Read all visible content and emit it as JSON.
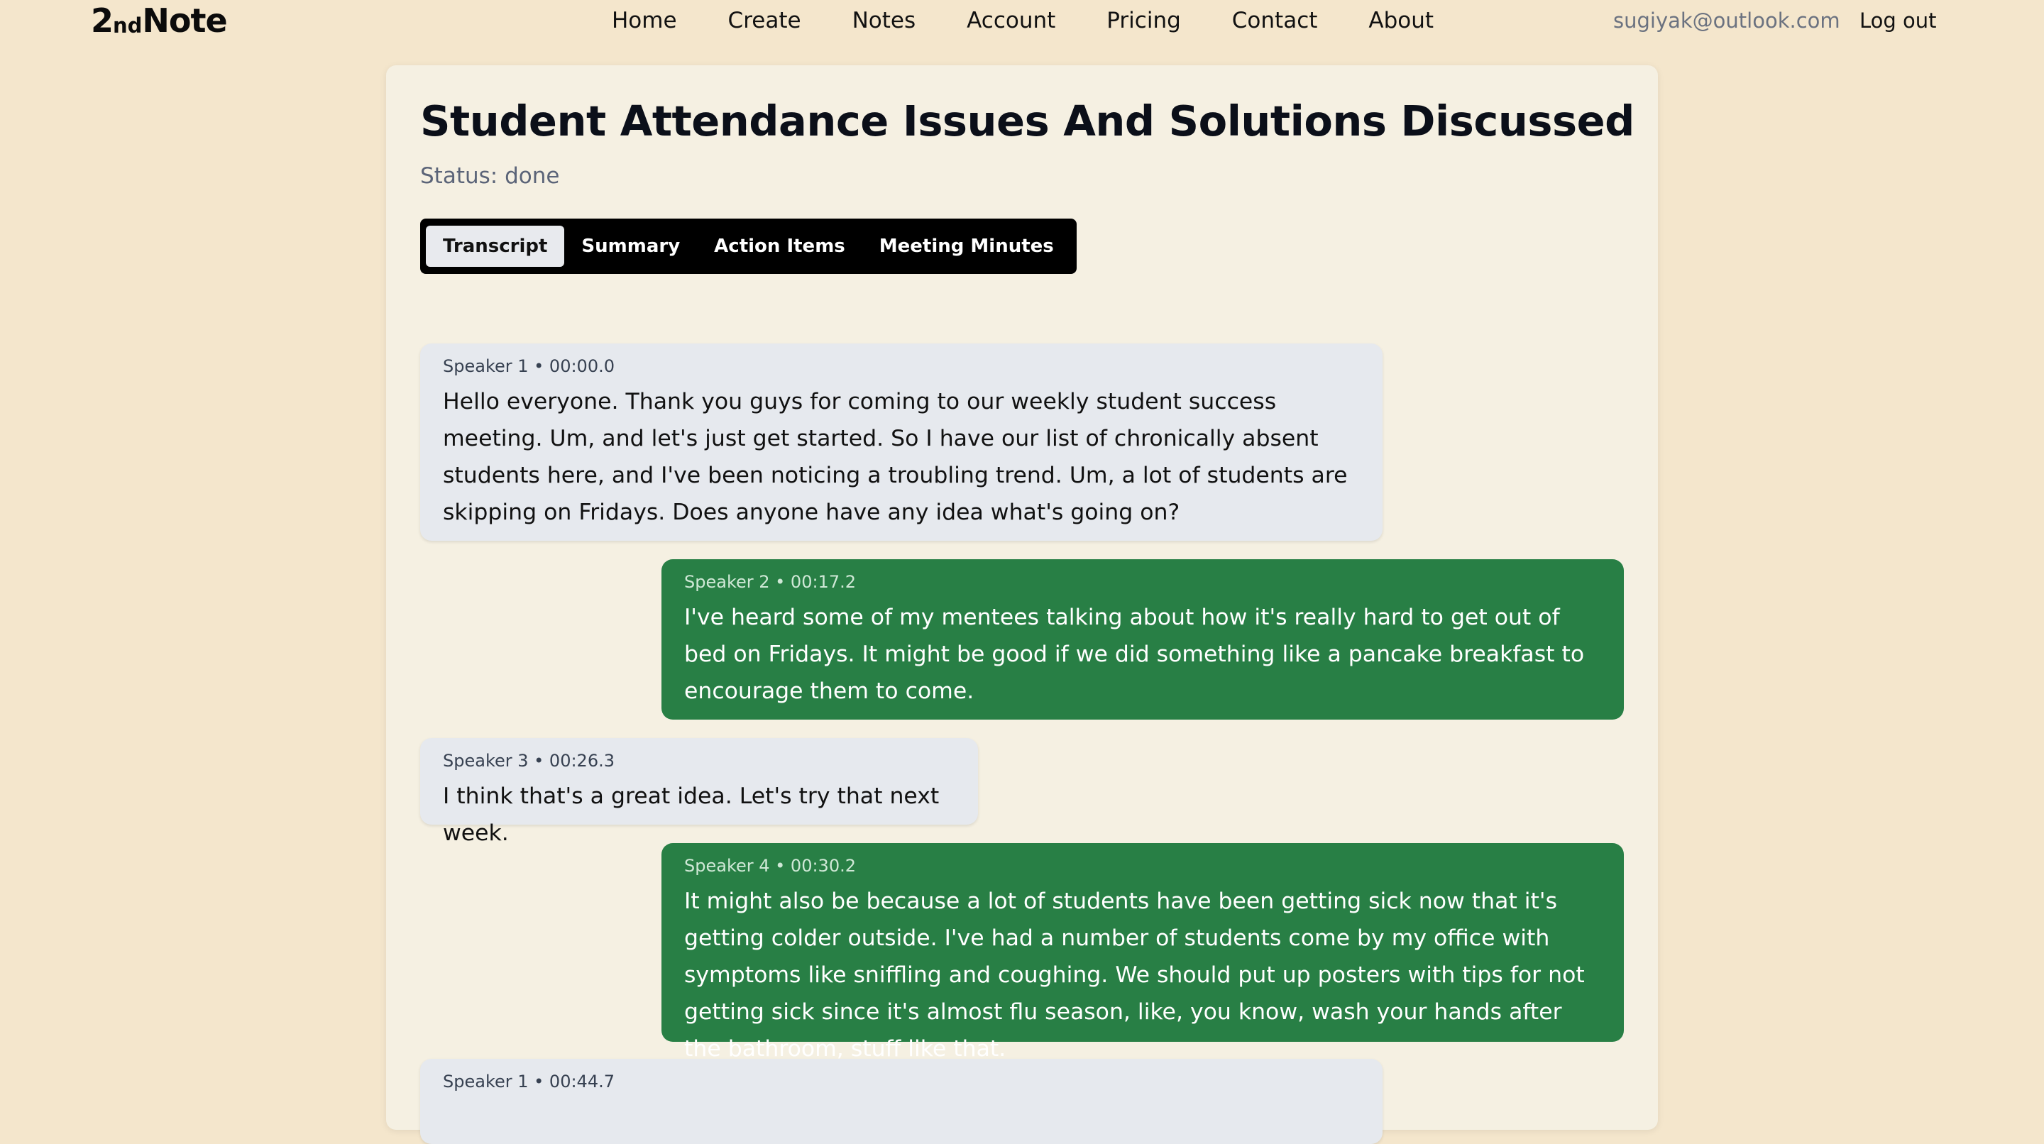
{
  "nav": {
    "logo_main": "2",
    "logo_sub": "nd",
    "logo_end": "Note",
    "links": [
      "Home",
      "Create",
      "Notes",
      "Account",
      "Pricing",
      "Contact",
      "About"
    ],
    "user_email": "sugiyak@outlook.com",
    "logout_label": "Log out"
  },
  "note": {
    "title": "Student Attendance Issues And Solutions Discussed",
    "status": "Status: done"
  },
  "tabs": [
    "Transcript",
    "Summary",
    "Action Items",
    "Meeting Minutes"
  ],
  "active_tab": "Transcript",
  "transcript": [
    {
      "meta": "Speaker 1 • 00:00.0",
      "text": "Hello everyone. Thank you guys for coming to our weekly student success meeting. Um, and let's just get started. So I have our list of chronically absent students here, and I've been noticing a troubling trend. Um, a lot of students are skipping on Fridays. Does anyone have any idea what's going on?"
    },
    {
      "meta": "Speaker 2 • 00:17.2",
      "text": "I've heard some of my mentees talking about how it's really hard to get out of bed on Fridays. It might be good if we did something like a pancake breakfast to encourage them to come."
    },
    {
      "meta": "Speaker 3 • 00:26.3",
      "text": "I think that's a great idea. Let's try that next week."
    },
    {
      "meta": "Speaker 4 • 00:30.2",
      "text": "It might also be because a lot of students have been getting sick now that it's getting colder outside. I've had a number of students come by my office with symptoms like sniffling and coughing. We should put up posters with tips for not getting sick since it's almost flu season, like, you know, wash your hands after the bathroom, stuff like that."
    },
    {
      "meta": "Speaker 1 • 00:44.7",
      "text": ""
    }
  ],
  "colors": {
    "background": "#f4e6cc",
    "card": "#f5f0e2",
    "bubble_left": "#e6e9ee",
    "bubble_right": "#287f45",
    "tabs_bar": "#000000"
  }
}
